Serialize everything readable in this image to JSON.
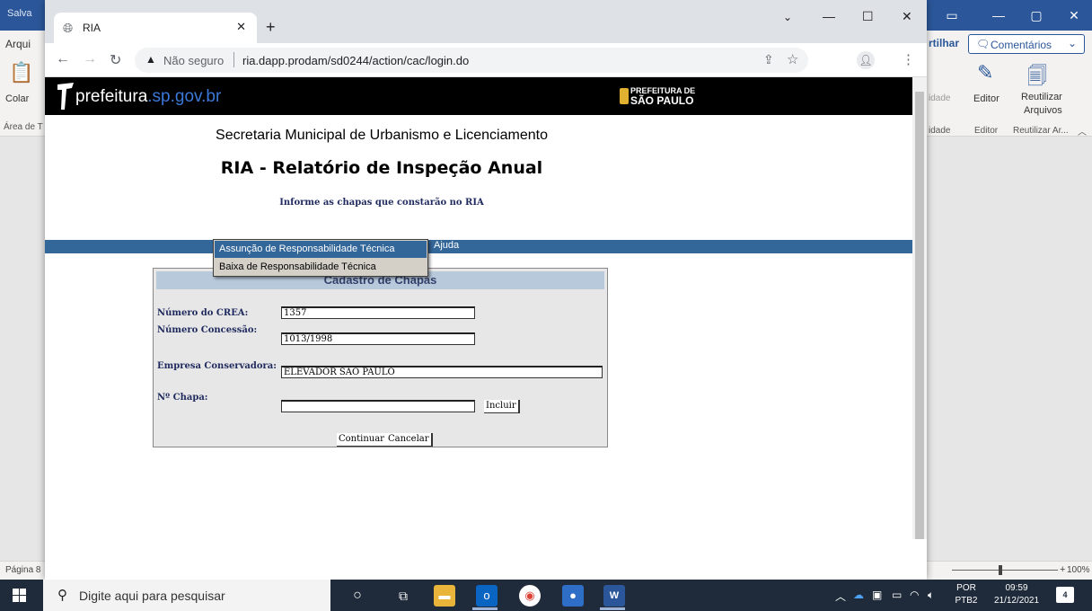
{
  "word": {
    "title_fragment": "Salva",
    "tab_fragment": "Arqui",
    "share_fragment": "rtilhar",
    "comments_label": "Comentários",
    "paste_label": "Colar",
    "clipboard_group": "Área de T",
    "editor_label": "Editor",
    "editor_group": "Editor",
    "reuse_label_1": "Reutilizar",
    "reuse_label_2": "Arquivos",
    "reuse_group": "Reutilizar Ar...",
    "frag_idade": "idade",
    "frag_idade2": "idade",
    "status_page": "Página 8",
    "zoom": "100%"
  },
  "chrome": {
    "tab_title": "RIA",
    "not_secure": "Não seguro",
    "url": "ria.dapp.prodam/sd0244/action/cac/login.do"
  },
  "page": {
    "logo_main": "prefeitura",
    "logo_domain": ".sp.gov.br",
    "pref_line1": "PREFEITURA DE",
    "pref_line2": "SÃO PAULO",
    "secretaria": "Secretaria Municipal de Urbanismo e Licenciamento",
    "title": "RIA - Relatório de Inspeção Anual",
    "subtitle": "Informe as chapas que constarão no RIA",
    "menu_ajuda": "Ajuda",
    "dropdown": [
      "Assunção de Responsabilidade Técnica",
      "Baixa de Responsabilidade Técnica"
    ],
    "form": {
      "heading": "Cadastro de Chapas",
      "crea_label": "Número do CREA:",
      "crea_value": "1357",
      "concessao_label": "Número Concessão:",
      "concessao_value": "1013/1998",
      "empresa_label": "Empresa Conservadora:",
      "empresa_value": "ELEVADOR SAO PAULO",
      "chapa_label": "Nº Chapa:",
      "chapa_value": "",
      "incluir": "Incluir",
      "continuar": "Continuar",
      "cancelar": "Cancelar"
    }
  },
  "taskbar": {
    "search_placeholder": "Digite aqui para pesquisar",
    "lang1": "POR",
    "lang2": "PTB2",
    "time": "09:59",
    "date": "21/12/2021",
    "notif_count": "4"
  },
  "colors": {
    "word_blue": "#2b579a",
    "menu_blue": "#336699",
    "form_header": "#b8c9dc"
  }
}
